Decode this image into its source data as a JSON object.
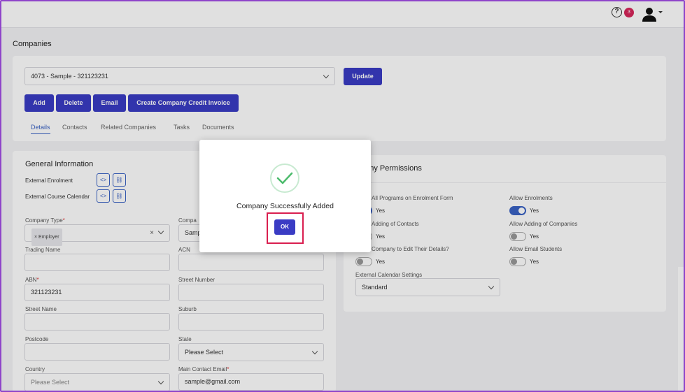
{
  "header": {
    "help_icon": "?",
    "notification_count": "3"
  },
  "page": {
    "title": "Companies"
  },
  "company_select": {
    "value": "4073 - Sample - 321123231"
  },
  "buttons": {
    "update": "Update",
    "add": "Add",
    "delete": "Delete",
    "email": "Email",
    "credit_invoice": "Create Company Credit Invoice"
  },
  "tabs": [
    "Details",
    "Contacts",
    "Related Companies",
    "Tasks",
    "Documents"
  ],
  "general": {
    "title": "General Information",
    "external_enrolment": "External Enrolment",
    "external_course_calendar": "External Course Calendar",
    "company_type_label": "Company Type",
    "company_type_chip": "Employer",
    "company_name_label": "Compa",
    "company_name_value": "Samp",
    "trading_name_label": "Trading Name",
    "acn_label": "ACN",
    "abn_label": "ABN",
    "abn_value": "321123231",
    "street_number_label": "Street Number",
    "street_name_label": "Street Name",
    "suburb_label": "Suburb",
    "postcode_label": "Postcode",
    "state_label": "State",
    "state_value": "Please Select",
    "country_label": "Country",
    "country_value": "Please Select",
    "main_contact_email_label": "Main Contact Email",
    "main_contact_email_value": "sample@gmail.com",
    "required_mark": "*"
  },
  "permissions": {
    "title": "pany Permissions",
    "items": [
      {
        "label": "All Programs on Enrolment Form",
        "text": "Yes",
        "on": true
      },
      {
        "label": "Allow Enrolments",
        "text": "Yes",
        "on": true
      },
      {
        "label": "Adding of Contacts",
        "text": "Yes",
        "on": false
      },
      {
        "label": "Allow Adding of Companies",
        "text": "Yes",
        "on": false
      },
      {
        "label": "Company to Edit Their Details?",
        "text": "Yes",
        "on": false
      },
      {
        "label": "Allow Email Students",
        "text": "Yes",
        "on": false
      }
    ],
    "calendar_label": "External Calendar Settings",
    "calendar_value": "Standard"
  },
  "modal": {
    "message": "Company Successfully Added",
    "ok": "OK",
    "accent": "#3a3cc4",
    "highlight": "#d91e4f"
  }
}
